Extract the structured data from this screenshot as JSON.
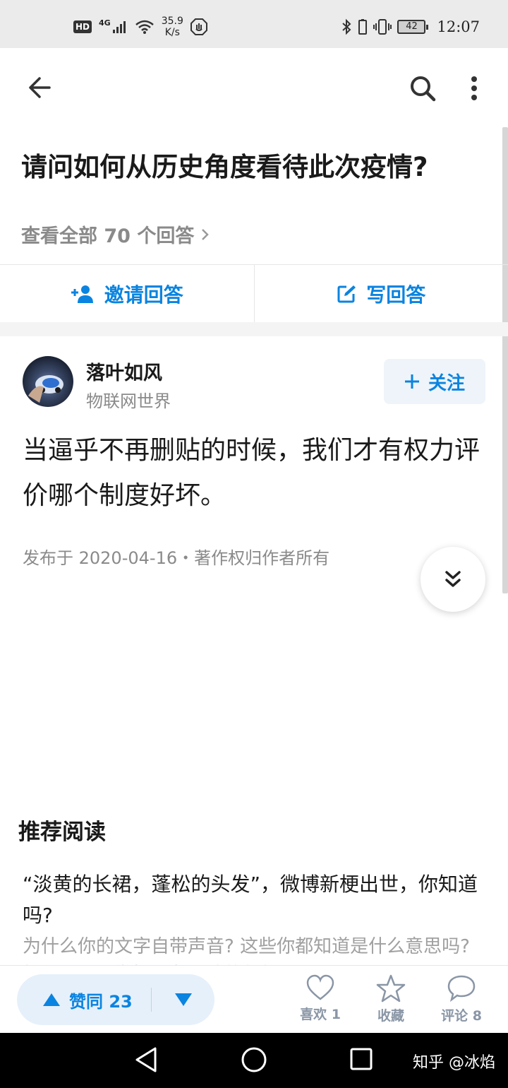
{
  "status_bar": {
    "hd": "HD",
    "network": "4G",
    "speed_value": "35.9",
    "speed_unit": "K/s",
    "battery": "42",
    "time": "12:07"
  },
  "question": {
    "title": "请问如何从历史角度看待此次疫情?",
    "view_all": "查看全部 70 个回答"
  },
  "actions": {
    "invite": "邀请回答",
    "write": "写回答"
  },
  "author": {
    "name": "落叶如风",
    "subtitle": "物联网世界",
    "follow": "关注"
  },
  "answer": {
    "content": "当逼乎不再删贴的时候，我们才有权力评价哪个制度好坏。",
    "meta": "发布于 2020-04-16・著作权归作者所有"
  },
  "recommend": {
    "title": "推荐阅读",
    "item_title": "“淡黄的长裙，蓬松的头发”，微博新梗出世，你知道吗?",
    "item_desc": "为什么你的文字自带声音? 这些你都知道是什么意思吗? 打开来看看微博网友们造的新梗!"
  },
  "bottom_bar": {
    "upvote": "赞同 23",
    "like": "喜欢 1",
    "collect": "收藏",
    "comment": "评论 8"
  },
  "watermark": "知乎 @冰焰",
  "colors": {
    "accent": "#0a84e0",
    "muted": "#8a8a8a",
    "status_bar_bg": "#ebebeb"
  }
}
